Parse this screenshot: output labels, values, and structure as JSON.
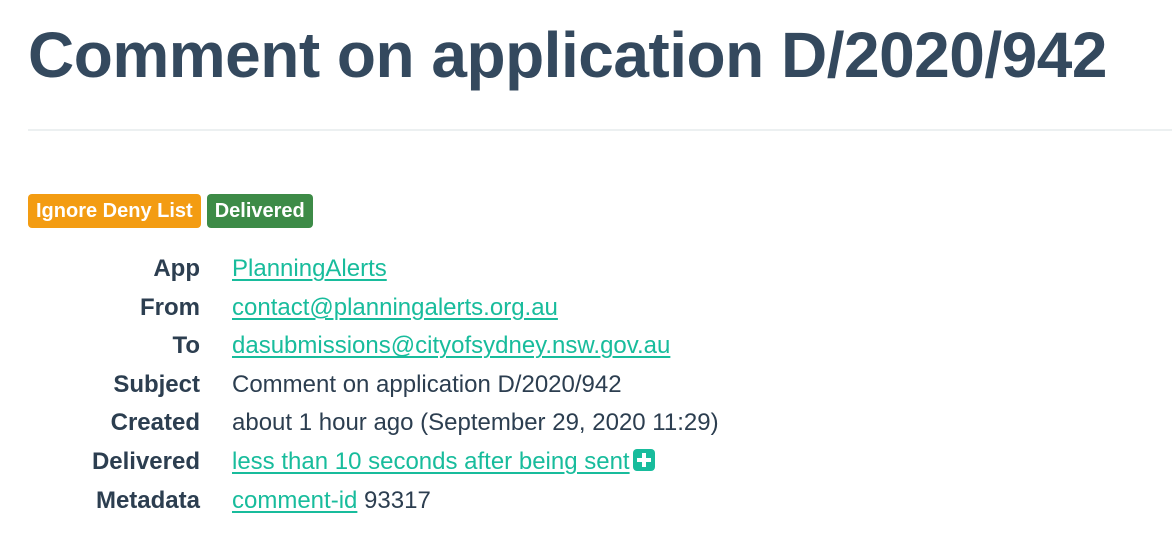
{
  "page": {
    "title": "Comment on application D/2020/942"
  },
  "badges": {
    "ignore_deny_list": "Ignore Deny List",
    "delivered": "Delivered"
  },
  "details": {
    "app": {
      "label": "App",
      "value": "PlanningAlerts"
    },
    "from": {
      "label": "From",
      "value": "contact@planningalerts.org.au"
    },
    "to": {
      "label": "To",
      "value": "dasubmissions@cityofsydney.nsw.gov.au"
    },
    "subject": {
      "label": "Subject",
      "value": "Comment on application D/2020/942"
    },
    "created": {
      "label": "Created",
      "value": "about 1 hour ago (September 29, 2020 11:29)"
    },
    "delivered": {
      "label": "Delivered",
      "value": "less than 10 seconds after being sent",
      "expand_icon": "plus-square-icon"
    },
    "metadata": {
      "label": "Metadata",
      "key": "comment-id",
      "value": "93317"
    }
  },
  "colors": {
    "heading": "#34495e",
    "link": "#18bc9c",
    "badge_warning": "#f39c12",
    "badge_success": "#3d8b47"
  }
}
